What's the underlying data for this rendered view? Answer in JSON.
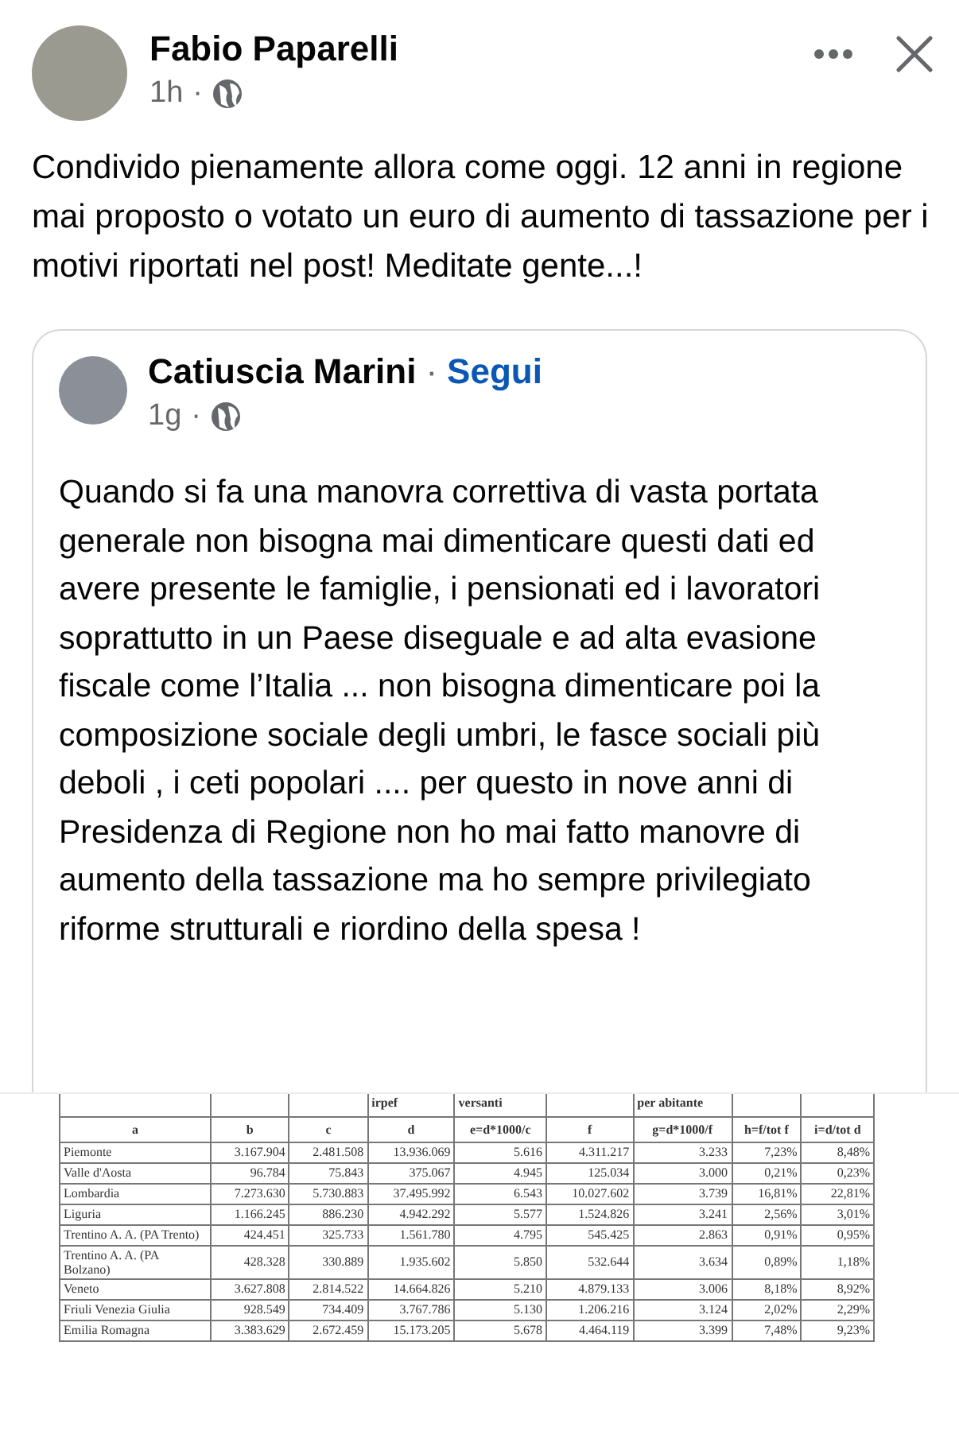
{
  "post": {
    "author": "Fabio Paparelli",
    "time": "1h",
    "separator": "·",
    "text": "Condivido pienamente allora come oggi. 12 anni in regione mai proposto o votato un euro di aumento di tassazione per i motivi riportati nel post! Meditate gente...!"
  },
  "shared_post": {
    "author": "Catiuscia Marini",
    "separator": "·",
    "follow_link": "Segui",
    "time": "1g",
    "time_separator": "·",
    "text": "Quando si fa una manovra correttiva di vasta portata generale non bisogna mai dimenticare questi dati ed avere presente le famiglie, i pensionati ed i lavoratori soprattutto in un Paese diseguale e ad alta evasione fiscale come l’Italia ... non bisogna dimenticare poi la composizione sociale degli umbri, le fasce  sociali più deboli , i ceti popolari .... per questo in nove anni di Presidenza di Regione non ho mai fatto manovre di aumento della tassazione ma ho sempre privilegiato riforme strutturali e riordino della spesa !",
    "table": {
      "top_labels": {
        "d": "irpef",
        "e": "versanti",
        "g": "per abitante"
      },
      "columns": [
        "a",
        "b",
        "c",
        "d",
        "e=d*1000/c",
        "f",
        "g=d*1000/f",
        "h=f/tot f",
        "i=d/tot d"
      ],
      "rows": [
        [
          "Piemonte",
          "3.167.904",
          "2.481.508",
          "13.936.069",
          "5.616",
          "4.311.217",
          "3.233",
          "7,23%",
          "8,48%"
        ],
        [
          "Valle d'Aosta",
          "96.784",
          "75.843",
          "375.067",
          "4.945",
          "125.034",
          "3.000",
          "0,21%",
          "0,23%"
        ],
        [
          "Lombardia",
          "7.273.630",
          "5.730.883",
          "37.495.992",
          "6.543",
          "10.027.602",
          "3.739",
          "16,81%",
          "22,81%"
        ],
        [
          "Liguria",
          "1.166.245",
          "886.230",
          "4.942.292",
          "5.577",
          "1.524.826",
          "3.241",
          "2,56%",
          "3,01%"
        ],
        [
          "Trentino A. A. (PA Trento)",
          "424.451",
          "325.733",
          "1.561.780",
          "4.795",
          "545.425",
          "2.863",
          "0,91%",
          "0,95%"
        ],
        [
          "Trentino A. A. (PA Bolzano)",
          "428.328",
          "330.889",
          "1.935.602",
          "5.850",
          "532.644",
          "3.634",
          "0,89%",
          "1,18%"
        ],
        [
          "Veneto",
          "3.627.808",
          "2.814.522",
          "14.664.826",
          "5.210",
          "4.879.133",
          "3.006",
          "8,18%",
          "8,92%"
        ],
        [
          "Friuli Venezia Giulia",
          "928.549",
          "734.409",
          "3.767.786",
          "5.130",
          "1.206.216",
          "3.124",
          "2,02%",
          "2,29%"
        ],
        [
          "Emilia Romagna",
          "3.383.629",
          "2.672.459",
          "15.173.205",
          "5.678",
          "4.464.119",
          "3.399",
          "7,48%",
          "9,23%"
        ]
      ]
    }
  }
}
